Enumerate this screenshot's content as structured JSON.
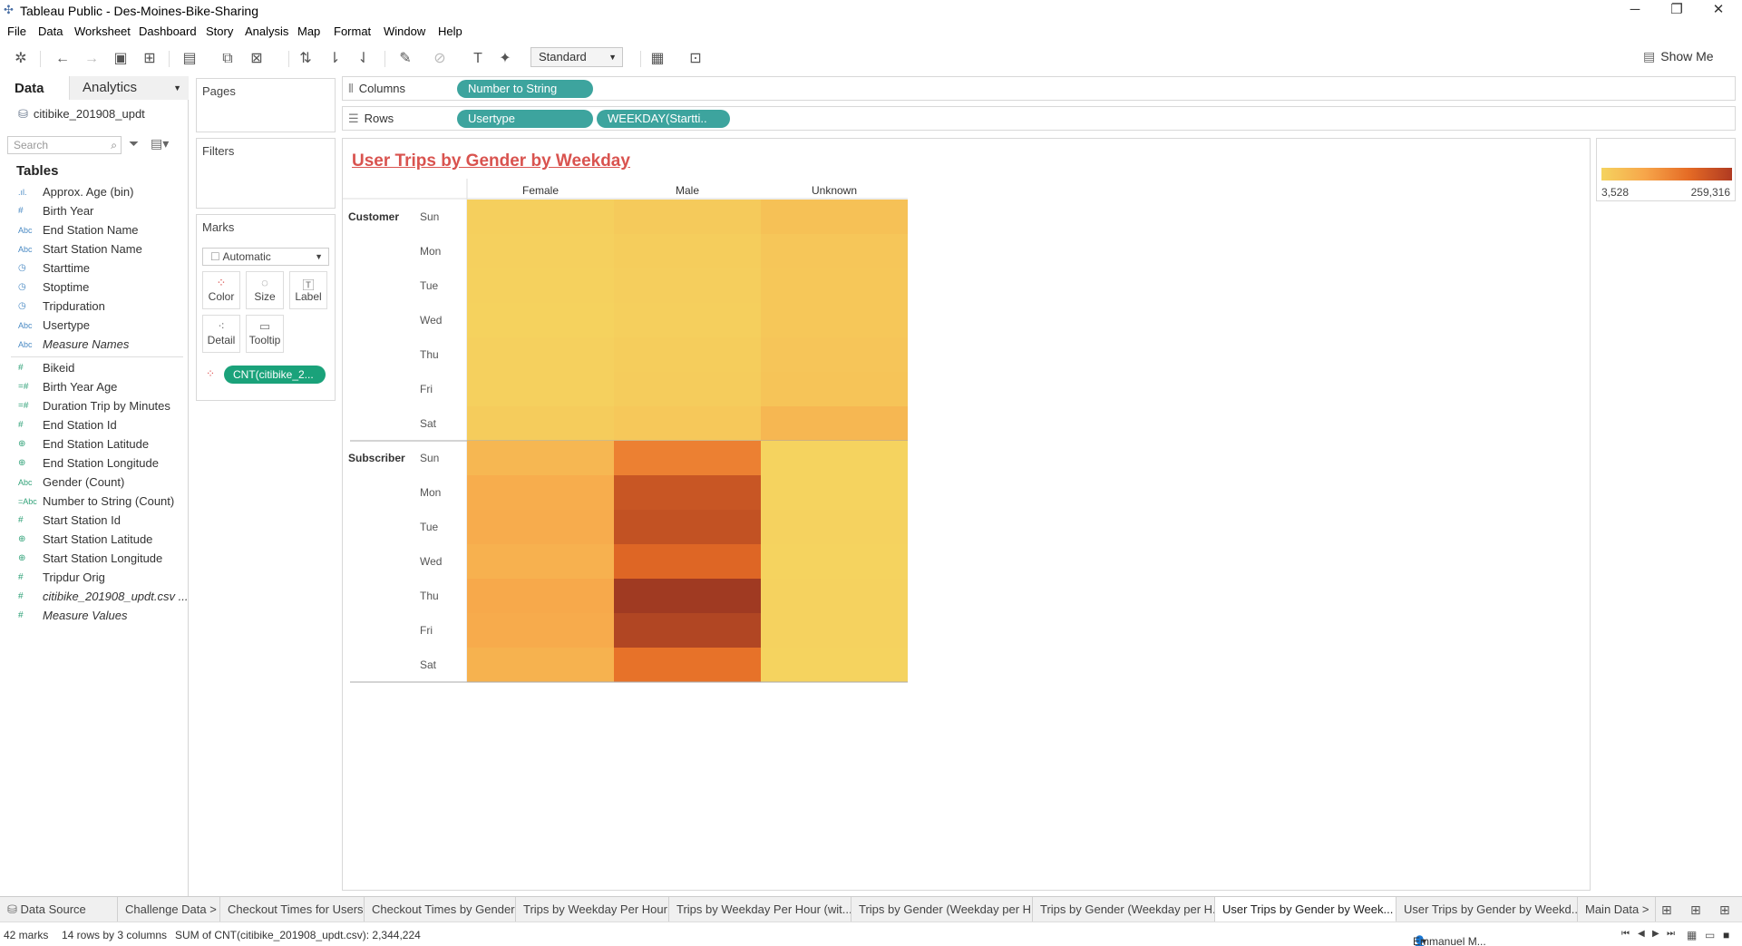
{
  "window": {
    "title": "Tableau Public - Des-Moines-Bike-Sharing",
    "min_glyph": "─",
    "restore_glyph": "❐",
    "close_glyph": "✕"
  },
  "menu": [
    "File",
    "Data",
    "Worksheet",
    "Dashboard",
    "Story",
    "Analysis",
    "Map",
    "Format",
    "Window",
    "Help"
  ],
  "toolbar": {
    "fit_select": "Standard",
    "show_me": "Show Me"
  },
  "data_pane": {
    "tab_data": "Data",
    "tab_analytics": "Analytics",
    "datasource": "citibike_201908_updt",
    "search_placeholder": "Search",
    "tables_heading": "Tables",
    "dimensions": [
      {
        "icon": ".ıl.",
        "name": "Approx. Age (bin)",
        "italic": false,
        "green": false
      },
      {
        "icon": "#",
        "name": "Birth Year",
        "italic": false,
        "green": false
      },
      {
        "icon": "Abc",
        "name": "End Station Name",
        "italic": false,
        "green": false
      },
      {
        "icon": "Abc",
        "name": "Start Station Name",
        "italic": false,
        "green": false
      },
      {
        "icon": "◷",
        "name": "Starttime",
        "italic": false,
        "green": false
      },
      {
        "icon": "◷",
        "name": "Stoptime",
        "italic": false,
        "green": false
      },
      {
        "icon": "◷",
        "name": "Tripduration",
        "italic": false,
        "green": false
      },
      {
        "icon": "Abc",
        "name": "Usertype",
        "italic": false,
        "green": false
      },
      {
        "icon": "Abc",
        "name": "Measure Names",
        "italic": true,
        "green": false
      }
    ],
    "measures": [
      {
        "icon": "#",
        "name": "Bikeid",
        "italic": false,
        "green": true
      },
      {
        "icon": "=#",
        "name": "Birth Year Age",
        "italic": false,
        "green": true
      },
      {
        "icon": "=#",
        "name": "Duration Trip by Minutes",
        "italic": false,
        "green": true
      },
      {
        "icon": "#",
        "name": "End Station Id",
        "italic": false,
        "green": true
      },
      {
        "icon": "⊕",
        "name": "End Station Latitude",
        "italic": false,
        "green": true
      },
      {
        "icon": "⊕",
        "name": "End Station Longitude",
        "italic": false,
        "green": true
      },
      {
        "icon": "Abc",
        "name": "Gender (Count)",
        "italic": false,
        "green": true
      },
      {
        "icon": "=Abc",
        "name": "Number to String (Count)",
        "italic": false,
        "green": true
      },
      {
        "icon": "#",
        "name": "Start Station Id",
        "italic": false,
        "green": true
      },
      {
        "icon": "⊕",
        "name": "Start Station Latitude",
        "italic": false,
        "green": true
      },
      {
        "icon": "⊕",
        "name": "Start Station Longitude",
        "italic": false,
        "green": true
      },
      {
        "icon": "#",
        "name": "Tripdur Orig",
        "italic": false,
        "green": true
      },
      {
        "icon": "#",
        "name": "citibike_201908_updt.csv ...",
        "italic": true,
        "green": true
      },
      {
        "icon": "#",
        "name": "Measure Values",
        "italic": true,
        "green": true
      }
    ]
  },
  "cards": {
    "pages": "Pages",
    "filters": "Filters",
    "marks": "Marks",
    "mark_type": "Automatic",
    "mark_buttons": [
      "Color",
      "Size",
      "Label",
      "Detail",
      "Tooltip"
    ],
    "color_pill": "CNT(citibike_2..."
  },
  "shelves": {
    "columns_label": "Columns",
    "rows_label": "Rows",
    "columns_pills": [
      "Number to String"
    ],
    "rows_pills": [
      "Usertype",
      "WEEKDAY(Startti.. "
    ]
  },
  "chart_data": {
    "type": "heatmap",
    "title": "User Trips by Gender by Weekday",
    "columns": [
      "Female",
      "Male",
      "Unknown"
    ],
    "row_groups": [
      "Customer",
      "Subscriber"
    ],
    "weekdays": [
      "Sun",
      "Mon",
      "Tue",
      "Wed",
      "Thu",
      "Fri",
      "Sat"
    ],
    "color_range": [
      3528,
      259316
    ],
    "cells": {
      "Customer": {
        "Female": [
          12000,
          9000,
          8000,
          6000,
          9000,
          9500,
          18000
        ],
        "Male": [
          21000,
          16000,
          14000,
          12000,
          15000,
          17000,
          26000
        ],
        "Unknown": [
          40000,
          30000,
          28000,
          27000,
          31000,
          34000,
          60000
        ]
      },
      "Subscriber": {
        "Female": [
          60000,
          80000,
          82000,
          72000,
          88000,
          84000,
          70000
        ],
        "Male": [
          150000,
          215000,
          222000,
          190000,
          259316,
          240000,
          172000
        ],
        "Unknown": [
          3528,
          4500,
          4800,
          4200,
          5000,
          4700,
          4000
        ]
      }
    }
  },
  "legend": {
    "min": "3,528",
    "max": "259,316"
  },
  "sheet_tabs": [
    "Data Source",
    "Challenge Data >",
    "Checkout Times for Users",
    "Checkout Times by Gender",
    "Trips by Weekday Per Hour",
    "Trips by Weekday Per Hour (wit...",
    "Trips by Gender (Weekday per H...",
    "Trips by Gender (Weekday per H...",
    "User Trips by Gender by Week...",
    "User Trips by Gender by Weekd...",
    "Main Data >"
  ],
  "active_tab_index": 8,
  "status": {
    "marks": "42 marks",
    "dims": "14 rows by 3 columns",
    "sum": "SUM of CNT(citibike_201908_updt.csv): 2,344,224",
    "user": "Emmanuel M..."
  }
}
